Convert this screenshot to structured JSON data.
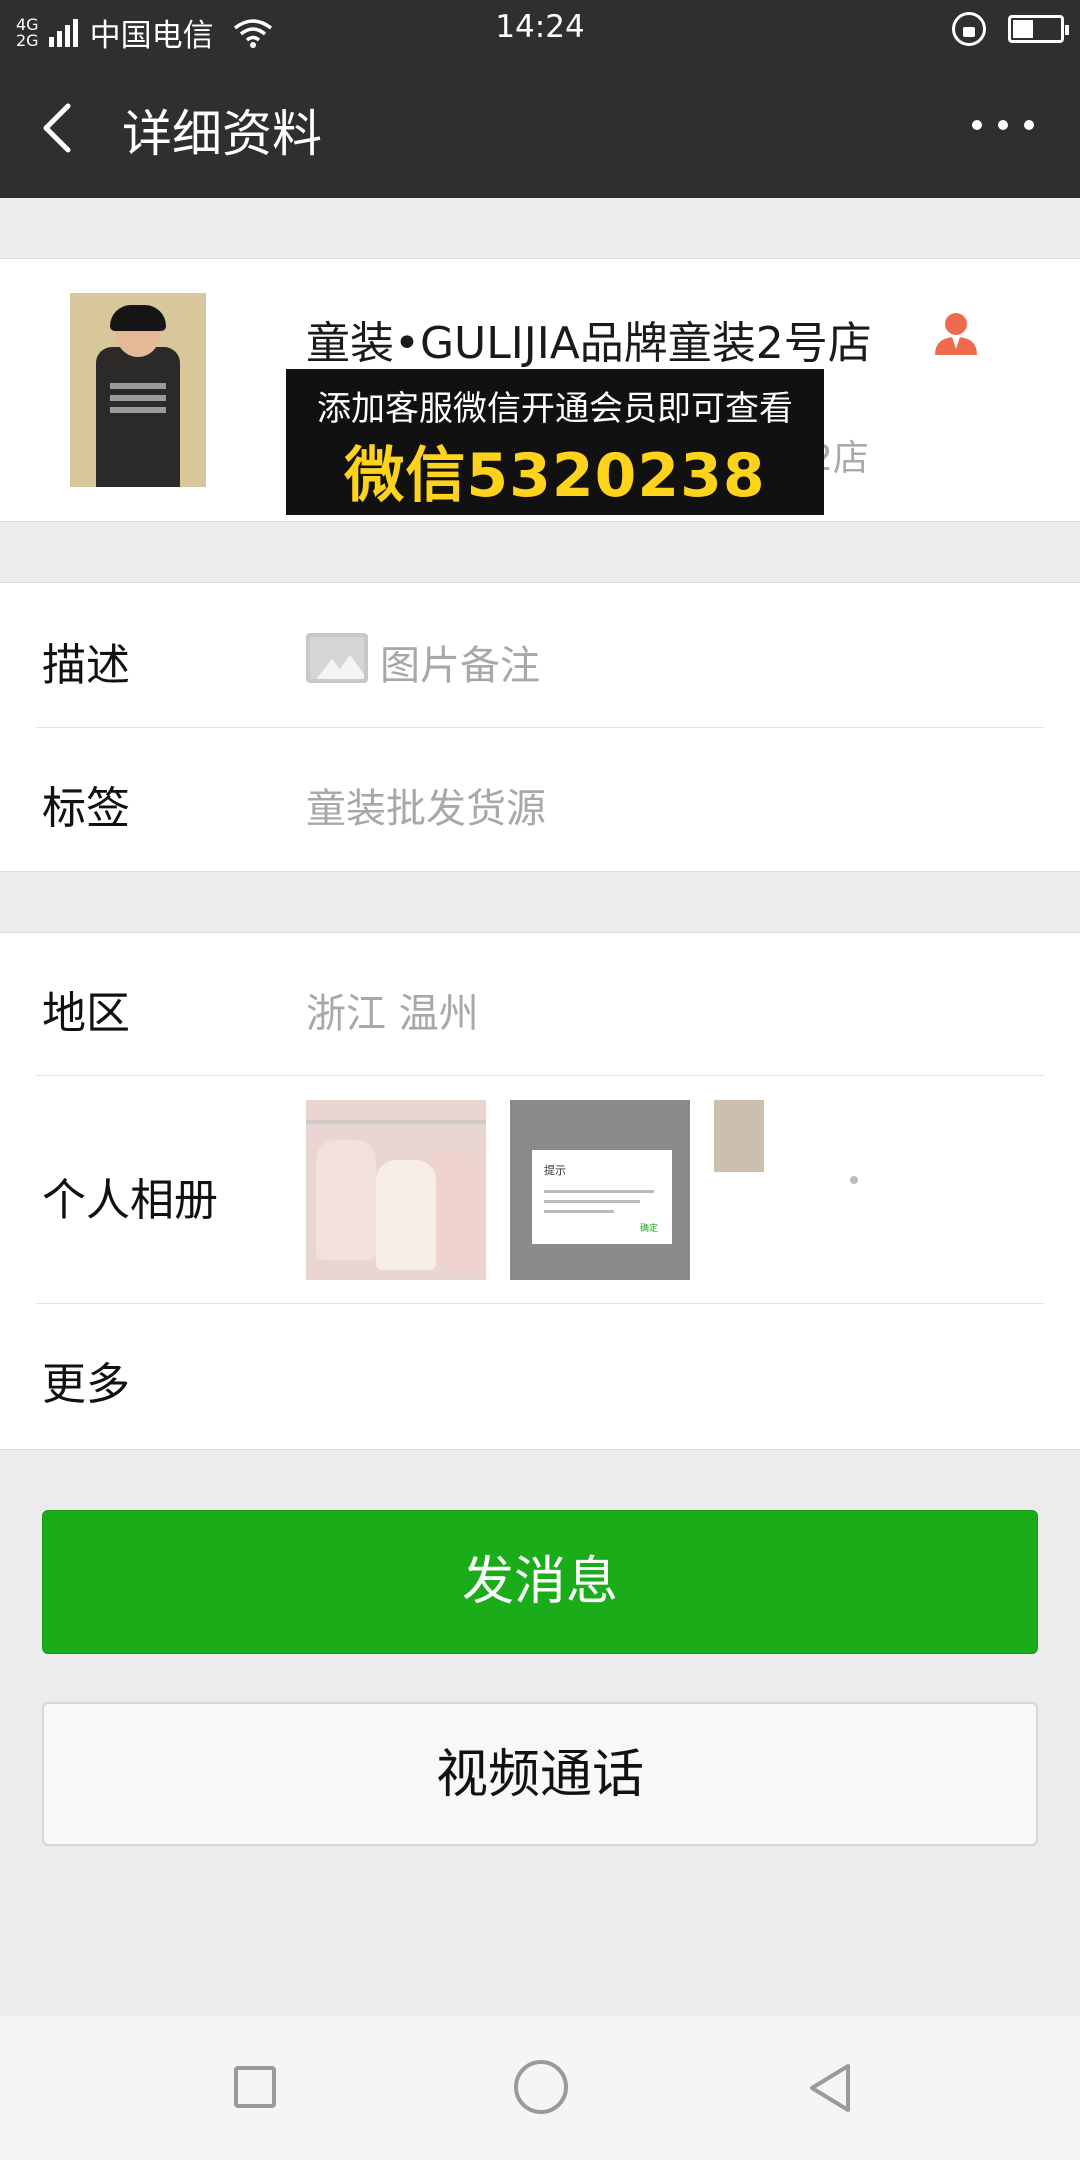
{
  "status_bar": {
    "network_top": "4G",
    "network_bottom": "2G",
    "carrier": "中国电信",
    "time": "14:24",
    "battery_level": 0.4
  },
  "header": {
    "title": "详细资料"
  },
  "profile": {
    "name": "童装•GULIJIA品牌童装2号店",
    "wechat_id_tail": "2店",
    "promo_line1": "添加客服微信开通会员即可查看",
    "promo_line2": "微信5320238"
  },
  "details": {
    "description_label": "描述",
    "description_value": "图片备注",
    "tags_label": "标签",
    "tags_value": "童装批发货源",
    "region_label": "地区",
    "region_value": "浙江  温州",
    "album_label": "个人相册",
    "album_thumb2_title": "提示",
    "album_thumb2_ok": "确定",
    "more_label": "更多"
  },
  "actions": {
    "send_message": "发消息",
    "video_call": "视频通话"
  },
  "colors": {
    "header_bg": "#2f2f2f",
    "primary_green": "#1aad19",
    "promo_yellow": "#ffd21c",
    "contact_icon": "#f06b4e"
  }
}
